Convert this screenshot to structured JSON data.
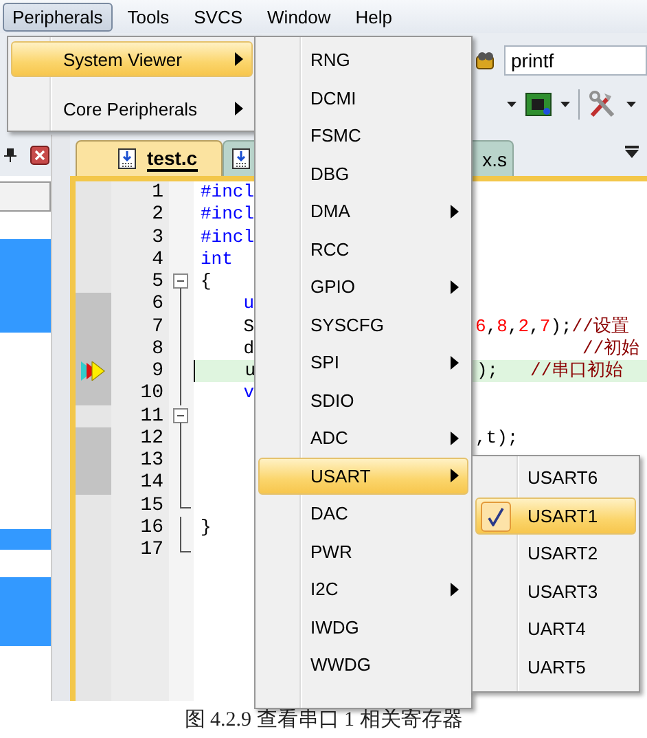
{
  "menubar": [
    {
      "label": "Peripherals",
      "selected": true
    },
    {
      "label": "Tools",
      "selected": false
    },
    {
      "label": "SVCS",
      "selected": false
    },
    {
      "label": "Window",
      "selected": false
    },
    {
      "label": "Help",
      "selected": false
    }
  ],
  "toolbar": {
    "search_value": "printf"
  },
  "editor_tabs": [
    {
      "label": "test.c",
      "selected": true
    },
    {
      "label": "x.s",
      "selected": false
    }
  ],
  "code_lines": [
    {
      "number": "1",
      "shaded": false,
      "current": false,
      "left": [
        {
          "text": "#incl",
          "kind": "keyword"
        }
      ]
    },
    {
      "number": "2",
      "shaded": false,
      "current": false,
      "left": [
        {
          "text": "#incl",
          "kind": "keyword"
        }
      ]
    },
    {
      "number": "3",
      "shaded": false,
      "current": false,
      "left": [
        {
          "text": "#incl",
          "kind": "keyword"
        }
      ]
    },
    {
      "number": "4",
      "shaded": false,
      "current": false,
      "left": [
        {
          "text": "int",
          "kind": "keyword"
        }
      ]
    },
    {
      "number": "5",
      "collapsible": true,
      "shaded": false,
      "current": false,
      "left": [
        {
          "text": "{",
          "kind": "plain"
        }
      ]
    },
    {
      "number": "6",
      "in_fold": true,
      "shaded": true,
      "current": false,
      "left": [
        {
          "text": "    u",
          "kind": "keyword"
        }
      ]
    },
    {
      "number": "7",
      "in_fold": true,
      "shaded": true,
      "current": false,
      "left": [
        {
          "text": "    S",
          "kind": "plain"
        }
      ],
      "right": [
        {
          "text": "6",
          "kind": "number"
        },
        {
          "text": ",",
          "kind": "plain"
        },
        {
          "text": "8",
          "kind": "number"
        },
        {
          "text": ",",
          "kind": "plain"
        },
        {
          "text": "2",
          "kind": "number"
        },
        {
          "text": ",",
          "kind": "plain"
        },
        {
          "text": "7",
          "kind": "number"
        },
        {
          "text": ");",
          "kind": "plain"
        },
        {
          "text": "//设置",
          "kind": "comment"
        }
      ]
    },
    {
      "number": "8",
      "in_fold": true,
      "shaded": true,
      "current": false,
      "left": [
        {
          "text": "    d",
          "kind": "plain"
        }
      ],
      "right": [
        {
          "text": "          //初始",
          "kind": "comment"
        }
      ]
    },
    {
      "number": "9",
      "in_fold": true,
      "shaded": true,
      "current": true,
      "left": [
        {
          "text": "    u",
          "kind": "plain"
        }
      ],
      "right": [
        {
          "text": ");   ",
          "kind": "plain"
        },
        {
          "text": "//串口初始",
          "kind": "comment"
        }
      ]
    },
    {
      "number": "10",
      "in_fold": true,
      "shaded": true,
      "current": false,
      "left": [
        {
          "text": "    v",
          "kind": "keyword"
        }
      ]
    },
    {
      "number": "11",
      "collapsible": true,
      "shaded": false,
      "current": false
    },
    {
      "number": "12",
      "in_fold": true,
      "shaded": true,
      "current": false,
      "right": [
        {
          "text": ",t);",
          "kind": "plain"
        }
      ]
    },
    {
      "number": "13",
      "in_fold": true,
      "shaded": true,
      "current": false
    },
    {
      "number": "14",
      "in_fold": true,
      "shaded": true,
      "current": false
    },
    {
      "number": "15",
      "fold_end": true,
      "shaded": false,
      "current": false
    },
    {
      "number": "16",
      "in_fold": true,
      "shaded": false,
      "current": false,
      "left": [
        {
          "text": "}",
          "kind": "plain"
        }
      ]
    },
    {
      "number": "17",
      "fold_end": true,
      "shaded": false,
      "current": false
    }
  ],
  "peripherals_menu": [
    {
      "label": "System Viewer",
      "selected": true,
      "has_submenu": true
    },
    {
      "label": "Core Peripherals",
      "selected": false,
      "has_submenu": true
    }
  ],
  "system_viewer_menu": [
    {
      "label": "RNG",
      "selected": false
    },
    {
      "label": "DCMI",
      "selected": false
    },
    {
      "label": "FSMC",
      "selected": false
    },
    {
      "label": "DBG",
      "selected": false
    },
    {
      "label": "DMA",
      "selected": false,
      "has_submenu": true
    },
    {
      "label": "RCC",
      "selected": false
    },
    {
      "label": "GPIO",
      "selected": false,
      "has_submenu": true
    },
    {
      "label": "SYSCFG",
      "selected": false
    },
    {
      "label": "SPI",
      "selected": false,
      "has_submenu": true
    },
    {
      "label": "SDIO",
      "selected": false
    },
    {
      "label": "ADC",
      "selected": false,
      "has_submenu": true
    },
    {
      "label": "USART",
      "selected": true,
      "has_submenu": true
    },
    {
      "label": "DAC",
      "selected": false
    },
    {
      "label": "PWR",
      "selected": false
    },
    {
      "label": "I2C",
      "selected": false,
      "has_submenu": true
    },
    {
      "label": "IWDG",
      "selected": false
    },
    {
      "label": "WWDG",
      "selected": false
    }
  ],
  "usart_menu": [
    {
      "label": "USART6",
      "selected": false,
      "checked": false
    },
    {
      "label": "USART1",
      "selected": true,
      "checked": true
    },
    {
      "label": "USART2",
      "selected": false,
      "checked": false
    },
    {
      "label": "USART3",
      "selected": false,
      "checked": false
    },
    {
      "label": "UART4",
      "selected": false,
      "checked": false
    },
    {
      "label": "UART5",
      "selected": false,
      "checked": false
    }
  ],
  "caption": "图 4.2.9 查看串口 1 相关寄存器"
}
